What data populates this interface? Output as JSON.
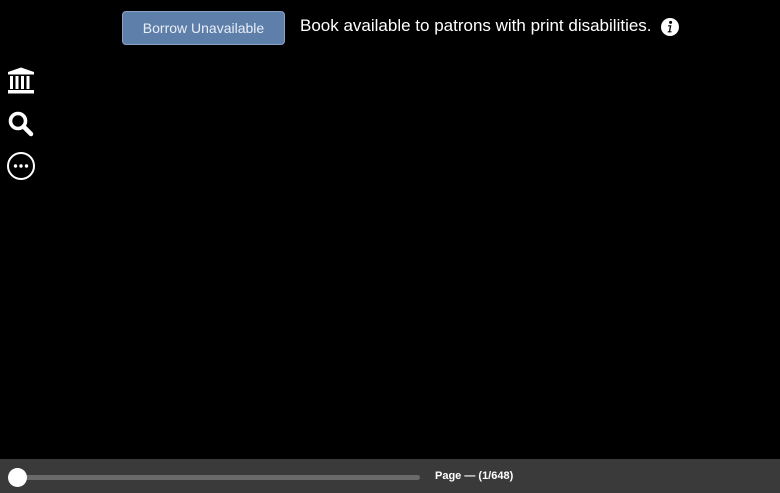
{
  "topbar": {
    "borrow_label": "Borrow Unavailable",
    "notice": "Book available to patrons with print disabilities.",
    "info_icon": "info-icon"
  },
  "sidebar": {
    "items": [
      {
        "icon": "archive-icon"
      },
      {
        "icon": "search-icon"
      },
      {
        "icon": "more-icon"
      }
    ]
  },
  "navigation": {
    "page_label": "Page — (1/648)",
    "current_page": 1,
    "total_pages": 648
  },
  "colors": {
    "background": "#000000",
    "button": "#5f7fab",
    "bottombar": "#3a3a3a"
  }
}
